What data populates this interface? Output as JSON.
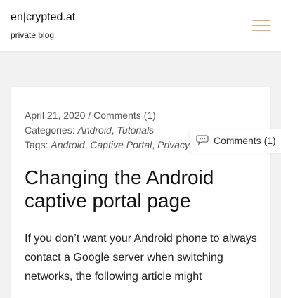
{
  "site": {
    "title": "en|crypted.at",
    "description": "private blog"
  },
  "menu": {
    "icon": "hamburger-menu-icon",
    "color": "#f0a868"
  },
  "post": {
    "date": "April 21, 2020",
    "separator": "/",
    "comments_link": "Comments (1)",
    "categories_label": "Categories:",
    "categories": [
      "Android",
      "Tutorials"
    ],
    "tags_label": "Tags:",
    "tags": [
      "Android",
      "Captive Portal",
      "Privacy"
    ],
    "title": "Changing the Android captive portal page",
    "excerpt": "If you don’t want your Android phone to always contact a Google server when switching networks, the following article might"
  },
  "comments_badge": {
    "icon": "comment-bubble-icon",
    "label": "Comments (1)"
  }
}
